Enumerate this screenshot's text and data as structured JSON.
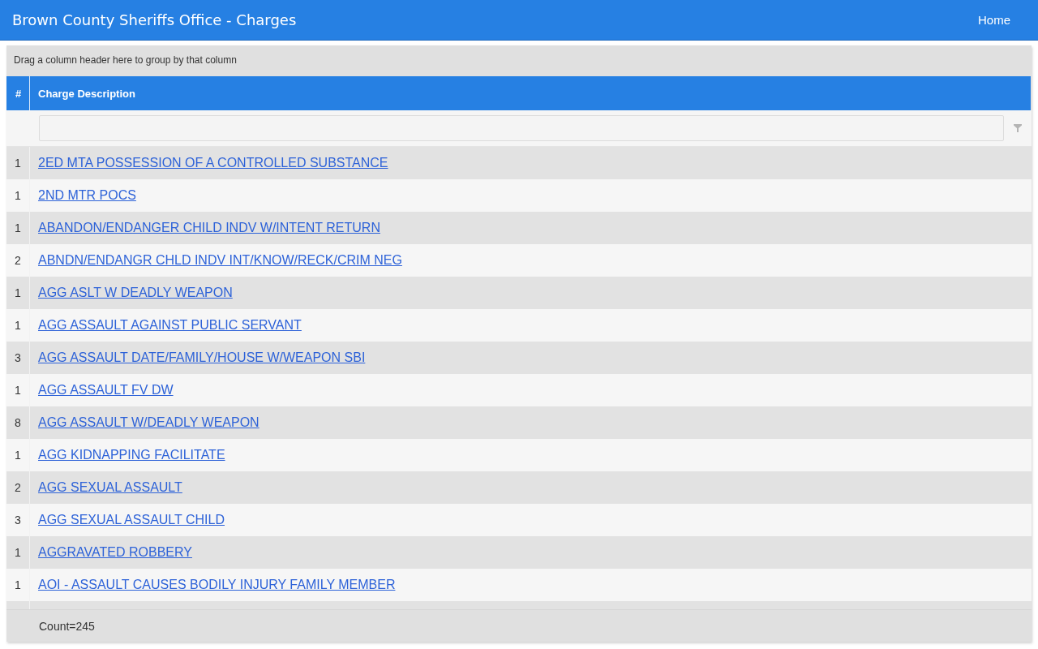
{
  "app_bar": {
    "title": "Brown County Sheriffs Office - Charges",
    "nav": [
      {
        "label": "Home"
      }
    ]
  },
  "grid": {
    "group_panel_hint": "Drag a column header here to group by that column",
    "columns": [
      {
        "label": "#"
      },
      {
        "label": "Charge Description"
      }
    ],
    "rows": [
      {
        "count": "1",
        "charge": "2ED MTA POSSESSION OF A CONTROLLED SUBSTANCE"
      },
      {
        "count": "1",
        "charge": "2ND MTR POCS"
      },
      {
        "count": "1",
        "charge": "ABANDON/ENDANGER CHILD INDV W/INTENT RETURN"
      },
      {
        "count": "2",
        "charge": "ABNDN/ENDANGR CHLD INDV INT/KNOW/RECK/CRIM NEG"
      },
      {
        "count": "1",
        "charge": "AGG ASLT W DEADLY WEAPON"
      },
      {
        "count": "1",
        "charge": "AGG ASSAULT AGAINST PUBLIC SERVANT"
      },
      {
        "count": "3",
        "charge": "AGG ASSAULT DATE/FAMILY/HOUSE W/WEAPON SBI"
      },
      {
        "count": "1",
        "charge": "AGG ASSAULT FV DW"
      },
      {
        "count": "8",
        "charge": "AGG ASSAULT W/DEADLY WEAPON"
      },
      {
        "count": "1",
        "charge": "AGG KIDNAPPING FACILITATE"
      },
      {
        "count": "2",
        "charge": "AGG SEXUAL ASSAULT"
      },
      {
        "count": "3",
        "charge": "AGG SEXUAL ASSAULT CHILD"
      },
      {
        "count": "1",
        "charge": "AGGRAVATED ROBBERY"
      },
      {
        "count": "1",
        "charge": "AOI - ASSAULT CAUSES BODILY INJURY FAMILY MEMBER"
      }
    ],
    "footer": {
      "count": "Count=245"
    }
  }
}
